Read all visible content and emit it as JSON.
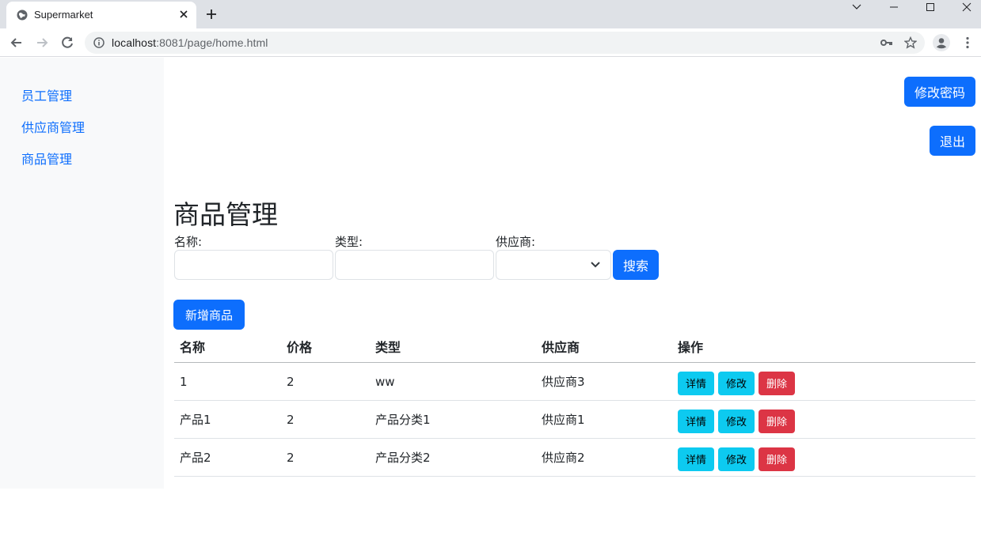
{
  "browser": {
    "tab_title": "Supermarket",
    "url_host": "localhost",
    "url_rest": ":8081/page/home.html",
    "icons": {
      "favicon": "globe-icon",
      "close": "close-icon",
      "new_tab": "plus-icon",
      "back": "arrow-left-icon",
      "forward": "arrow-right-icon",
      "reload": "reload-icon",
      "site_info": "info-icon",
      "passwords": "key-icon",
      "bookmark": "star-icon",
      "profile": "profile-icon",
      "menu": "kebab-menu-icon"
    }
  },
  "sidebar": {
    "items": [
      {
        "label": "员工管理"
      },
      {
        "label": "供应商管理"
      },
      {
        "label": "商品管理"
      }
    ]
  },
  "header": {
    "change_password": "修改密码",
    "logout": "退出"
  },
  "main": {
    "title": "商品管理",
    "filters": {
      "name_label": "名称:",
      "name_value": "",
      "type_label": "类型:",
      "type_value": "",
      "supplier_label": "供应商:",
      "supplier_value": "",
      "search_button": "搜索"
    },
    "add_button": "新增商品",
    "table": {
      "columns": [
        "名称",
        "价格",
        "类型",
        "供应商",
        "操作"
      ],
      "rows": [
        {
          "name": "1",
          "price": "2",
          "type": "ww",
          "supplier": "供应商3"
        },
        {
          "name": "产品1",
          "price": "2",
          "type": "产品分类1",
          "supplier": "供应商1"
        },
        {
          "name": "产品2",
          "price": "2",
          "type": "产品分类2",
          "supplier": "供应商2"
        }
      ],
      "actions": {
        "detail": "详情",
        "edit": "修改",
        "delete": "删除"
      }
    }
  },
  "colors": {
    "primary": "#0d6efd",
    "info": "#0dcaf0",
    "danger": "#dc3545",
    "sidebar_bg": "#f8f9fa"
  }
}
